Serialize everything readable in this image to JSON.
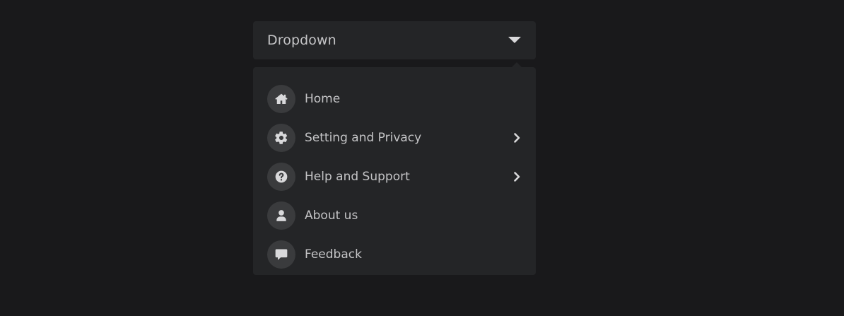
{
  "dropdown": {
    "label": "Dropdown",
    "caret_icon": "caret-down-icon"
  },
  "menu": {
    "items": [
      {
        "label": "Home",
        "icon": "home-icon",
        "has_submenu": false
      },
      {
        "label": "Setting and Privacy",
        "icon": "gear-icon",
        "has_submenu": true
      },
      {
        "label": "Help and Support",
        "icon": "question-icon",
        "has_submenu": true
      },
      {
        "label": "About us",
        "icon": "user-icon",
        "has_submenu": false
      },
      {
        "label": "Feedback",
        "icon": "message-icon",
        "has_submenu": false
      }
    ]
  },
  "colors": {
    "background": "#19191b",
    "panel": "#242527",
    "icon_circle": "#3a3b3d",
    "text": "#c4c4c6",
    "icon": "#d9d9db"
  }
}
